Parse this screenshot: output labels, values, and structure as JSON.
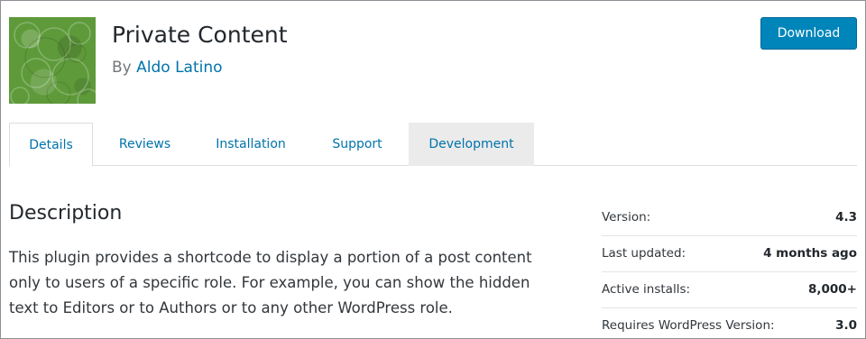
{
  "plugin": {
    "title": "Private Content",
    "by_prefix": "By ",
    "author": "Aldo Latino",
    "download_label": "Download"
  },
  "tabs": [
    {
      "label": "Details",
      "active": true
    },
    {
      "label": "Reviews",
      "active": false
    },
    {
      "label": "Installation",
      "active": false
    },
    {
      "label": "Support",
      "active": false
    },
    {
      "label": "Development",
      "active": false
    }
  ],
  "description": {
    "heading": "Description",
    "text": "This plugin provides a shortcode to display a portion of a post content only to users of a specific role. For example, you can show the hidden text to Editors or to Authors or to any other WordPress role."
  },
  "meta": [
    {
      "key": "Version:",
      "value": "4.3"
    },
    {
      "key": "Last updated:",
      "value": "4 months ago"
    },
    {
      "key": "Active installs:",
      "value": "8,000+"
    },
    {
      "key": "Requires WordPress Version:",
      "value": "3.0"
    }
  ],
  "colors": {
    "accent": "#0073aa",
    "button": "#0085ba",
    "banner": "#5e9a3a"
  }
}
